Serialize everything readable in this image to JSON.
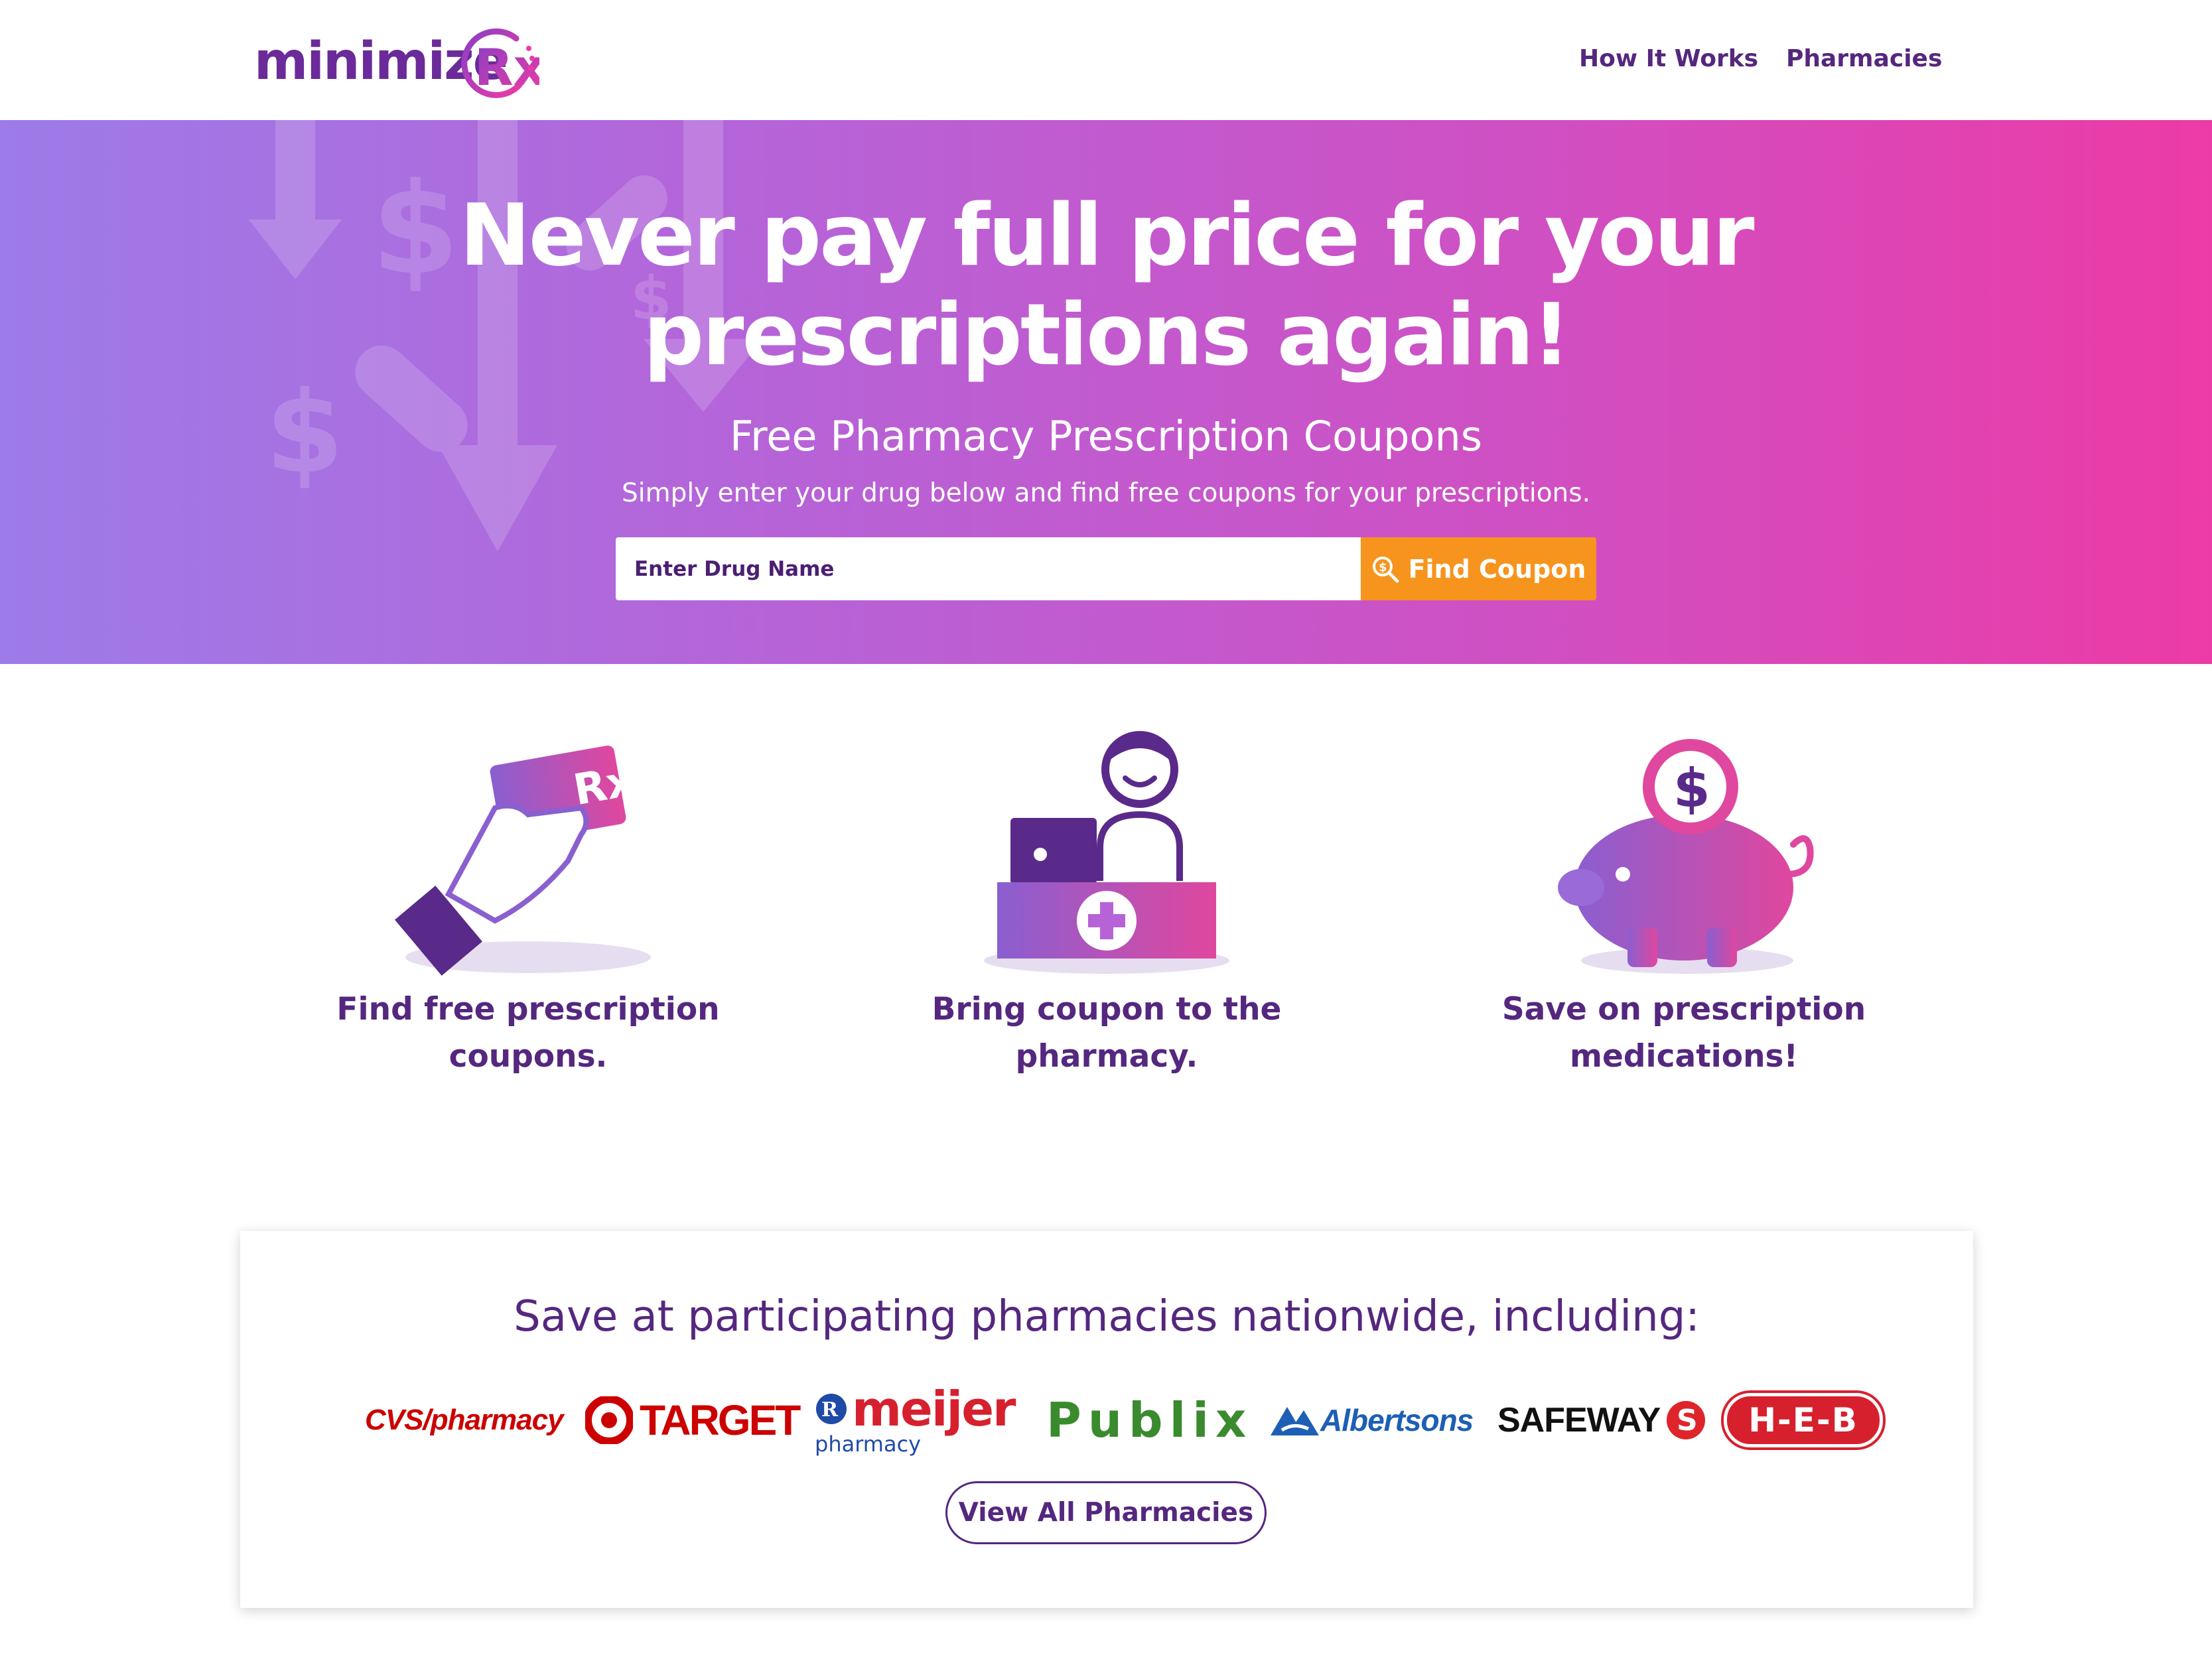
{
  "header": {
    "logo_text": "minimize",
    "logo_mark": "Rx",
    "nav": [
      {
        "label": "How It Works"
      },
      {
        "label": "Pharmacies"
      }
    ]
  },
  "hero": {
    "title_line1": "Never pay full price for your",
    "title_line2": "prescriptions again!",
    "subtitle": "Free Pharmacy Prescription Coupons",
    "description": "Simply enter your drug below and find free coupons for your prescriptions.",
    "search_placeholder": "Enter Drug Name",
    "search_button": "Find Coupon"
  },
  "steps": [
    {
      "line1": "Find free prescription",
      "line2": "coupons.",
      "icon": "hand-rx-card-icon"
    },
    {
      "line1": "Bring coupon to the",
      "line2": "pharmacy.",
      "icon": "pharmacist-counter-icon"
    },
    {
      "line1": "Save on prescription",
      "line2": "medications!",
      "icon": "piggy-bank-icon"
    }
  ],
  "pharmacies": {
    "title": "Save at participating pharmacies nationwide, including:",
    "logos": {
      "cvs": "CVS/pharmacy",
      "target": "TARGET",
      "meijer": "meijer",
      "meijer_sub": "pharmacy",
      "publix": "Publix",
      "albertsons": "Albertsons",
      "safeway": "SAFEWAY",
      "heb": "H-E-B"
    },
    "view_all": "View All Pharmacies"
  },
  "colors": {
    "brand_purple": "#55277f",
    "accent_orange": "#f7941d",
    "hero_gradient_start": "#9d7be8",
    "hero_gradient_end": "#ec3ba6"
  }
}
